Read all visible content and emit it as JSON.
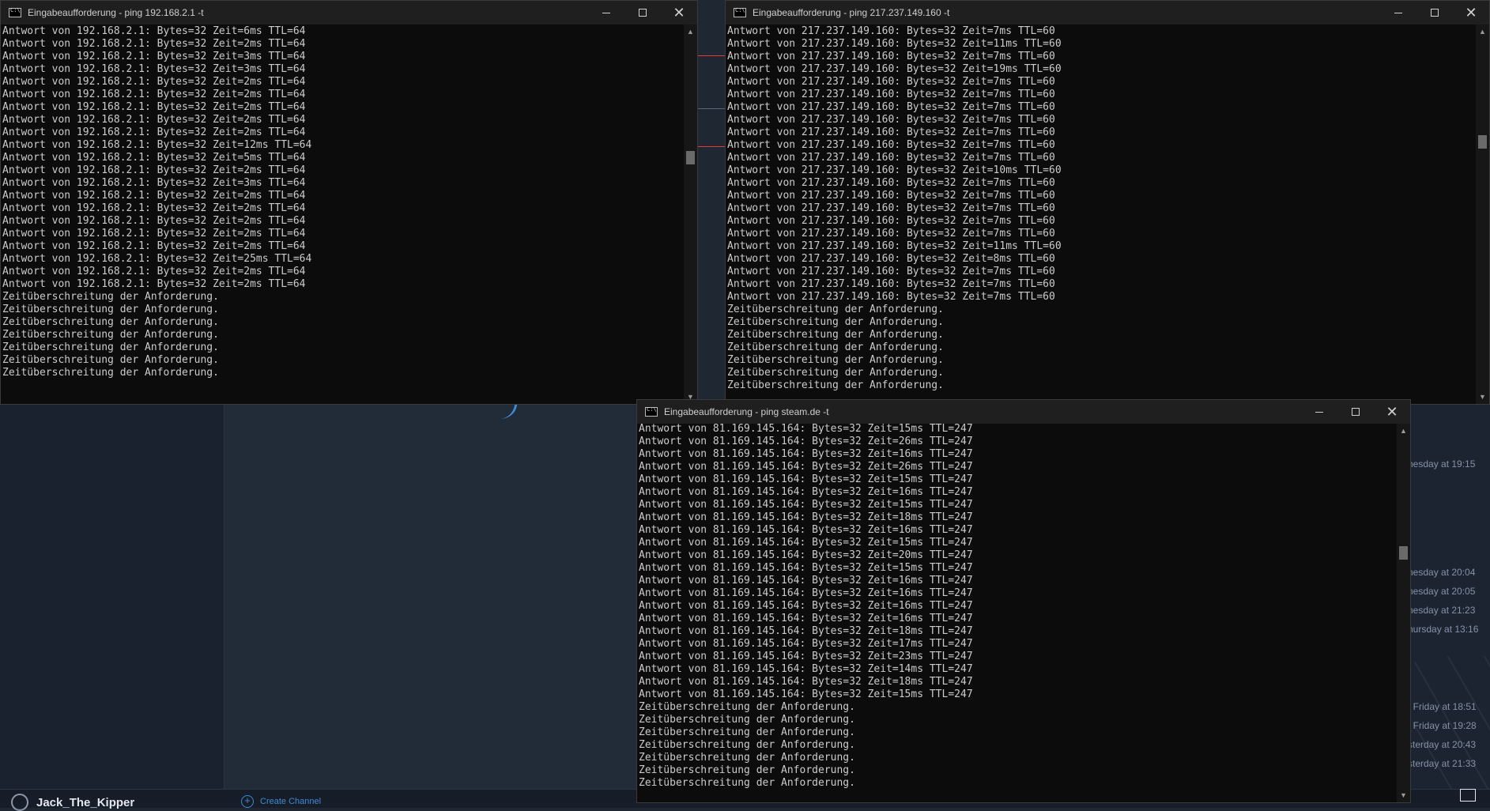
{
  "background_app": {
    "username": "Jack_The_Kipper",
    "create_channel_label": "Create Channel",
    "timestamps": [
      "nesday at 19:15",
      "nesday at 20:04",
      "nesday at 20:05",
      "nesday at 21:23",
      "hursday at 13:16",
      "t Friday at 18:51",
      "t Friday at 19:28",
      "sterday at 20:43",
      "sterday at 21:33"
    ]
  },
  "windows": [
    {
      "title": "Eingabeaufforderung - ping  192.168.2.1 -t",
      "lines": [
        "Antwort von 192.168.2.1: Bytes=32 Zeit=6ms TTL=64",
        "Antwort von 192.168.2.1: Bytes=32 Zeit=2ms TTL=64",
        "Antwort von 192.168.2.1: Bytes=32 Zeit=3ms TTL=64",
        "Antwort von 192.168.2.1: Bytes=32 Zeit=3ms TTL=64",
        "Antwort von 192.168.2.1: Bytes=32 Zeit=2ms TTL=64",
        "Antwort von 192.168.2.1: Bytes=32 Zeit=2ms TTL=64",
        "Antwort von 192.168.2.1: Bytes=32 Zeit=2ms TTL=64",
        "Antwort von 192.168.2.1: Bytes=32 Zeit=2ms TTL=64",
        "Antwort von 192.168.2.1: Bytes=32 Zeit=2ms TTL=64",
        "Antwort von 192.168.2.1: Bytes=32 Zeit=12ms TTL=64",
        "Antwort von 192.168.2.1: Bytes=32 Zeit=5ms TTL=64",
        "Antwort von 192.168.2.1: Bytes=32 Zeit=2ms TTL=64",
        "Antwort von 192.168.2.1: Bytes=32 Zeit=3ms TTL=64",
        "Antwort von 192.168.2.1: Bytes=32 Zeit=2ms TTL=64",
        "Antwort von 192.168.2.1: Bytes=32 Zeit=2ms TTL=64",
        "Antwort von 192.168.2.1: Bytes=32 Zeit=2ms TTL=64",
        "Antwort von 192.168.2.1: Bytes=32 Zeit=2ms TTL=64",
        "Antwort von 192.168.2.1: Bytes=32 Zeit=2ms TTL=64",
        "Antwort von 192.168.2.1: Bytes=32 Zeit=25ms TTL=64",
        "Antwort von 192.168.2.1: Bytes=32 Zeit=2ms TTL=64",
        "Antwort von 192.168.2.1: Bytes=32 Zeit=2ms TTL=64",
        "Zeitüberschreitung der Anforderung.",
        "Zeitüberschreitung der Anforderung.",
        "Zeitüberschreitung der Anforderung.",
        "Zeitüberschreitung der Anforderung.",
        "Zeitüberschreitung der Anforderung.",
        "Zeitüberschreitung der Anforderung.",
        "Zeitüberschreitung der Anforderung."
      ]
    },
    {
      "title": "Eingabeaufforderung - ping  217.237.149.160 -t",
      "lines": [
        "Antwort von 217.237.149.160: Bytes=32 Zeit=7ms TTL=60",
        "Antwort von 217.237.149.160: Bytes=32 Zeit=11ms TTL=60",
        "Antwort von 217.237.149.160: Bytes=32 Zeit=7ms TTL=60",
        "Antwort von 217.237.149.160: Bytes=32 Zeit=19ms TTL=60",
        "Antwort von 217.237.149.160: Bytes=32 Zeit=7ms TTL=60",
        "Antwort von 217.237.149.160: Bytes=32 Zeit=7ms TTL=60",
        "Antwort von 217.237.149.160: Bytes=32 Zeit=7ms TTL=60",
        "Antwort von 217.237.149.160: Bytes=32 Zeit=7ms TTL=60",
        "Antwort von 217.237.149.160: Bytes=32 Zeit=7ms TTL=60",
        "Antwort von 217.237.149.160: Bytes=32 Zeit=7ms TTL=60",
        "Antwort von 217.237.149.160: Bytes=32 Zeit=7ms TTL=60",
        "Antwort von 217.237.149.160: Bytes=32 Zeit=10ms TTL=60",
        "Antwort von 217.237.149.160: Bytes=32 Zeit=7ms TTL=60",
        "Antwort von 217.237.149.160: Bytes=32 Zeit=7ms TTL=60",
        "Antwort von 217.237.149.160: Bytes=32 Zeit=7ms TTL=60",
        "Antwort von 217.237.149.160: Bytes=32 Zeit=7ms TTL=60",
        "Antwort von 217.237.149.160: Bytes=32 Zeit=7ms TTL=60",
        "Antwort von 217.237.149.160: Bytes=32 Zeit=11ms TTL=60",
        "Antwort von 217.237.149.160: Bytes=32 Zeit=8ms TTL=60",
        "Antwort von 217.237.149.160: Bytes=32 Zeit=7ms TTL=60",
        "Antwort von 217.237.149.160: Bytes=32 Zeit=7ms TTL=60",
        "Antwort von 217.237.149.160: Bytes=32 Zeit=7ms TTL=60",
        "Zeitüberschreitung der Anforderung.",
        "Zeitüberschreitung der Anforderung.",
        "Zeitüberschreitung der Anforderung.",
        "Zeitüberschreitung der Anforderung.",
        "Zeitüberschreitung der Anforderung.",
        "Zeitüberschreitung der Anforderung.",
        "Zeitüberschreitung der Anforderung."
      ]
    },
    {
      "title": "Eingabeaufforderung - ping  steam.de -t",
      "lines": [
        "Antwort von 81.169.145.164: Bytes=32 Zeit=15ms TTL=247",
        "Antwort von 81.169.145.164: Bytes=32 Zeit=26ms TTL=247",
        "Antwort von 81.169.145.164: Bytes=32 Zeit=16ms TTL=247",
        "Antwort von 81.169.145.164: Bytes=32 Zeit=26ms TTL=247",
        "Antwort von 81.169.145.164: Bytes=32 Zeit=15ms TTL=247",
        "Antwort von 81.169.145.164: Bytes=32 Zeit=16ms TTL=247",
        "Antwort von 81.169.145.164: Bytes=32 Zeit=15ms TTL=247",
        "Antwort von 81.169.145.164: Bytes=32 Zeit=18ms TTL=247",
        "Antwort von 81.169.145.164: Bytes=32 Zeit=16ms TTL=247",
        "Antwort von 81.169.145.164: Bytes=32 Zeit=15ms TTL=247",
        "Antwort von 81.169.145.164: Bytes=32 Zeit=20ms TTL=247",
        "Antwort von 81.169.145.164: Bytes=32 Zeit=15ms TTL=247",
        "Antwort von 81.169.145.164: Bytes=32 Zeit=16ms TTL=247",
        "Antwort von 81.169.145.164: Bytes=32 Zeit=16ms TTL=247",
        "Antwort von 81.169.145.164: Bytes=32 Zeit=16ms TTL=247",
        "Antwort von 81.169.145.164: Bytes=32 Zeit=16ms TTL=247",
        "Antwort von 81.169.145.164: Bytes=32 Zeit=18ms TTL=247",
        "Antwort von 81.169.145.164: Bytes=32 Zeit=17ms TTL=247",
        "Antwort von 81.169.145.164: Bytes=32 Zeit=23ms TTL=247",
        "Antwort von 81.169.145.164: Bytes=32 Zeit=14ms TTL=247",
        "Antwort von 81.169.145.164: Bytes=32 Zeit=18ms TTL=247",
        "Antwort von 81.169.145.164: Bytes=32 Zeit=15ms TTL=247",
        "Zeitüberschreitung der Anforderung.",
        "Zeitüberschreitung der Anforderung.",
        "Zeitüberschreitung der Anforderung.",
        "Zeitüberschreitung der Anforderung.",
        "Zeitüberschreitung der Anforderung.",
        "Zeitüberschreitung der Anforderung.",
        "Zeitüberschreitung der Anforderung."
      ]
    }
  ]
}
